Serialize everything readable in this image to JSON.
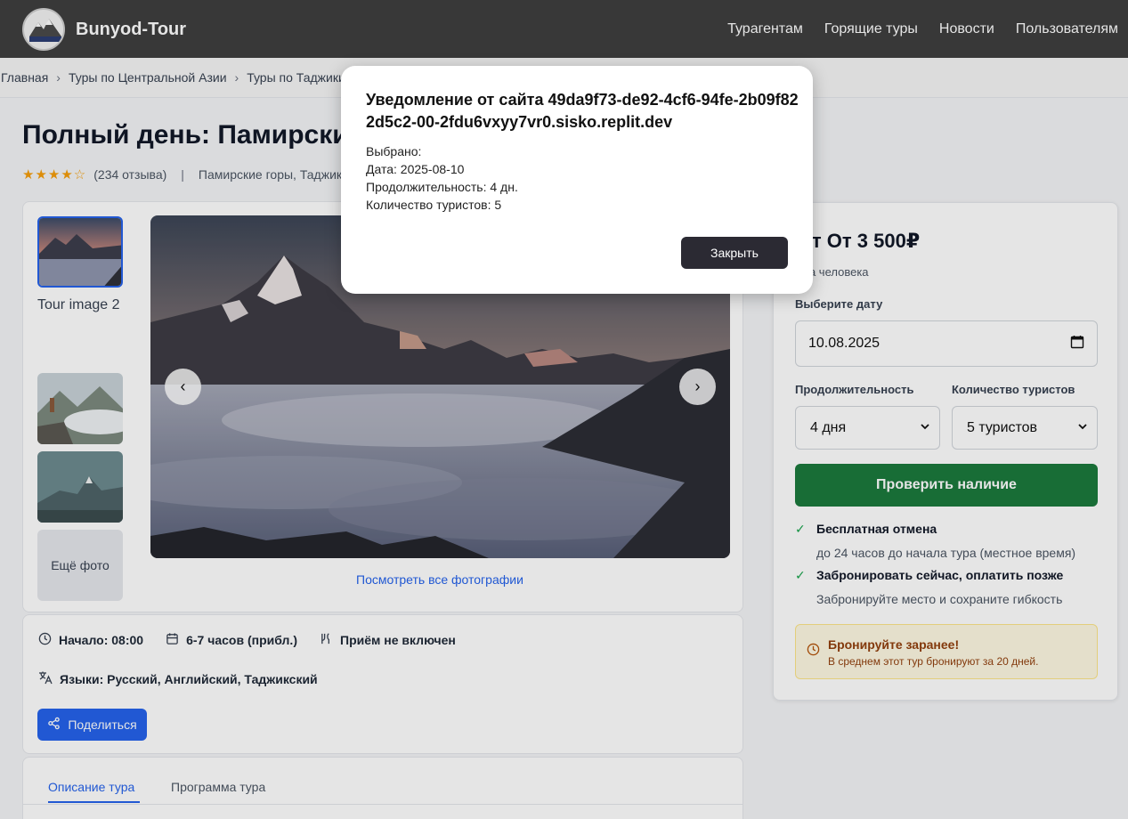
{
  "header": {
    "brand": "Bunyod-Tour",
    "logo_text": "Bunyod-Tour",
    "nav": [
      "Турагентам",
      "Горящие туры",
      "Новости",
      "Пользователям"
    ]
  },
  "breadcrumb": {
    "items": [
      "Главная",
      "Туры по Центральной Азии",
      "Туры по Таджикистану"
    ],
    "separator": "›"
  },
  "tour": {
    "title": "Полный день: Памирские горы",
    "stars": "★★★★☆",
    "reviews": "(234 отзыва)",
    "divider": "|",
    "location": "Памирские горы, Таджикистан"
  },
  "gallery": {
    "thumb2_alt": "Tour image 2",
    "more_photos": "Ещё фото",
    "prev_icon": "‹",
    "next_icon": "›",
    "view_all": "Посмотреть все фотографии"
  },
  "info": {
    "start": "Начало: 08:00",
    "duration": "6-7 часов (прибл.)",
    "meal": "Приём не включен",
    "languages": "Языки: Русский, Английский, Таджикский",
    "share": "Поделиться",
    "icons": {
      "clock": "clock-icon",
      "calendar": "calendar-icon",
      "meal": "utensils-icon",
      "language": "translate-icon",
      "share": "share-icon"
    }
  },
  "tabs": [
    "Описание тура",
    "Программа тура"
  ],
  "booking": {
    "price": "От 3 500₽",
    "price_prefix": "от",
    "per": "за человека",
    "date_label": "Выберите дату",
    "date_value": "10.08.2025",
    "duration_label": "Продолжительность",
    "duration_value": "4 дня",
    "tourists_label": "Количество туристов",
    "tourists_value": "5 туристов",
    "check_button": "Проверить наличие",
    "features": [
      {
        "title": "Бесплатная отмена",
        "sub": "до 24 часов до начала тура (местное время)"
      },
      {
        "title": "Забронировать сейчас, оплатить позже",
        "sub": "Забронируйте место и сохраните гибкость"
      }
    ],
    "notice_title": "Бронируйте заранее!",
    "notice_sub": "В среднем этот тур бронируют за 20 дней."
  },
  "dialog": {
    "title": "Уведомление от сайта 49da9f73-de92-4cf6-94fe-2b09f822d5c2-00-2fdu6vxyy7vr0.sisko.replit.dev",
    "lines": [
      "Выбрано:",
      "Дата: 2025-08-10",
      "Продолжительность: 4 дн.",
      "Количество туристов: 5"
    ],
    "close": "Закрыть"
  },
  "colors": {
    "header_bg": "#3f3f3f",
    "accent_blue": "#2563eb",
    "check_green": "#1b7a3d",
    "star": "#f59e0b",
    "dialog_button": "#2b2a33"
  }
}
